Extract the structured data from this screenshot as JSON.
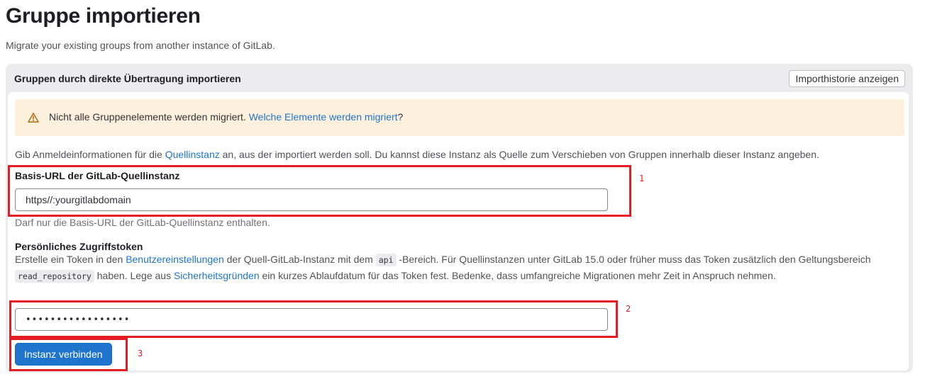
{
  "page": {
    "title": "Gruppe importieren",
    "subtitle": "Migrate your existing groups from another instance of GitLab."
  },
  "card": {
    "title": "Gruppen durch direkte Übertragung importieren",
    "history_button": "Importhistorie anzeigen"
  },
  "alert": {
    "icon": "warning-icon",
    "text": "Nicht alle Gruppenelemente werden migriert. ",
    "link": "Welche Elemente werden migriert",
    "suffix": "?"
  },
  "intro": {
    "before": "Gib Anmeldeinformationen für die ",
    "link": "Quellinstanz",
    "after": " an, aus der importiert werden soll. Du kannst diese Instanz als Quelle zum Verschieben von Gruppen innerhalb dieser Instanz angeben."
  },
  "url_field": {
    "label": "Basis-URL der GitLab-Quellinstanz",
    "value": "https//:yourgitlabdomain",
    "help": "Darf nur die Basis-URL der GitLab-Quellinstanz enthalten."
  },
  "token_field": {
    "label": "Persönliches Zugriffstoken",
    "desc_1": "Erstelle ein Token in den ",
    "link_1": "Benutzereinstellungen",
    "desc_2": " der Quell-GitLab-Instanz mit dem ",
    "code_1": "api",
    "desc_3": " -Bereich. Für Quellinstanzen unter GitLab 15.0 oder früher muss das Token zusätzlich den Geltungsbereich ",
    "code_2": "read_repository",
    "desc_4": " haben. Lege aus ",
    "link_2": "Sicherheitsgründen",
    "desc_5": " ein kurzes Ablaufdatum für das Token fest. Bedenke, dass umfangreiche Migrationen mehr Zeit in Anspruch nehmen.",
    "value_masked": "•••••••••••••••••"
  },
  "connect_button": "Instanz verbinden",
  "annotations": [
    "1",
    "2",
    "3"
  ],
  "colors": {
    "primary": "#1f75cb",
    "annotation": "#e51c23",
    "alert_bg": "#fdf1dd",
    "warning": "#ab6100"
  }
}
